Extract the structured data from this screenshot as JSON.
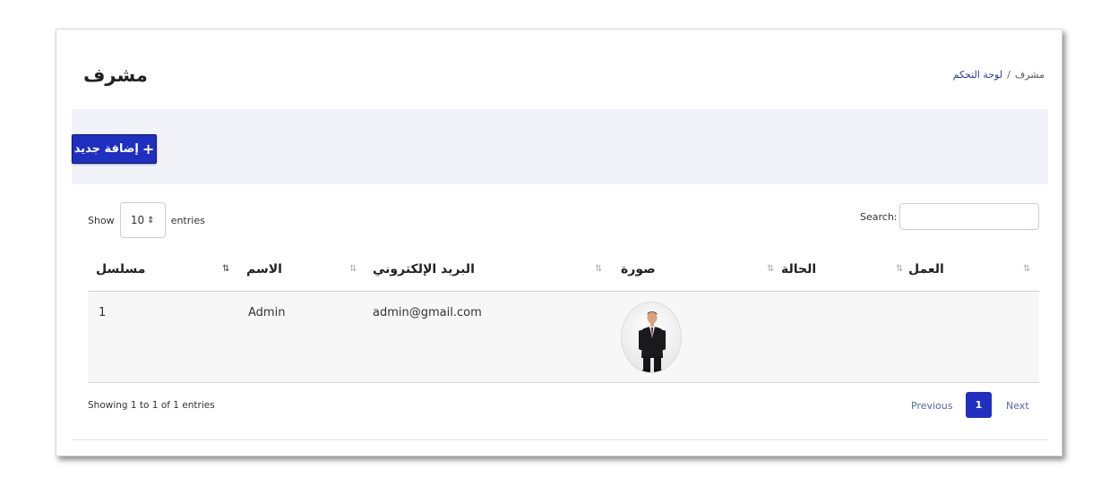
{
  "header": {
    "title": "مشرف",
    "breadcrumb": {
      "link": "لوحة التحكم",
      "separator": "/",
      "current": "مشرف"
    }
  },
  "toolbar": {
    "add_label": "إضافة جديد",
    "add_icon": "+"
  },
  "table_controls": {
    "show_label": "Show",
    "entries_value": "10",
    "entries_arrow": "⇕",
    "entries_label": "entries",
    "search_label": "Search:",
    "search_value": ""
  },
  "table": {
    "columns": [
      "مسلسل",
      "الاسم",
      "البريد الإلكتروني",
      "صورة",
      "الحالة",
      "العمل"
    ],
    "sort_icon": "⇅",
    "rows": [
      {
        "serial": "1",
        "name": "Admin",
        "email": "admin@gmail.com",
        "photo": "avatar-man-in-suit",
        "status": "",
        "action": ""
      }
    ]
  },
  "footer": {
    "info": "Showing 1 to 1 of 1 entries",
    "previous": "Previous",
    "page": "1",
    "next": "Next"
  },
  "colors": {
    "primary": "#1f2fbf",
    "toolbar_bg": "#f1f3f9",
    "link": "#2d3a9b"
  }
}
